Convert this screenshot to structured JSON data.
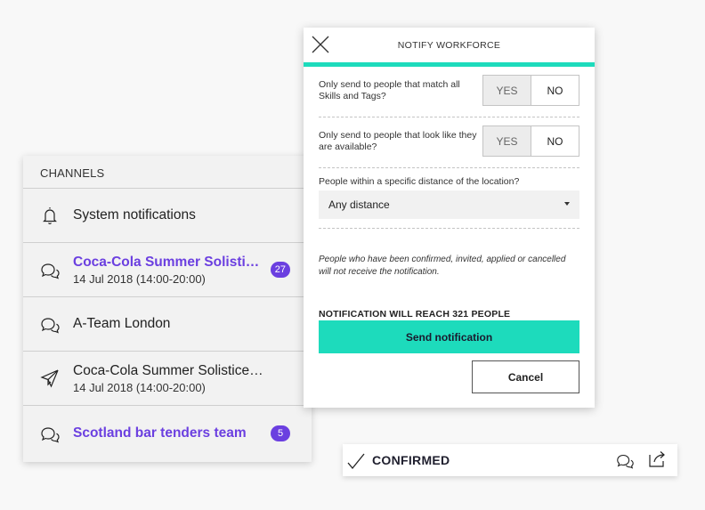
{
  "channels": {
    "header": "CHANNELS",
    "items": [
      {
        "icon": "bell-icon",
        "title": "System notifications",
        "subtitle": "",
        "badge": "",
        "unread": false
      },
      {
        "icon": "chat-bubbles-icon",
        "title": "Coca-Cola Summer Solistic…",
        "subtitle": "14 Jul 2018 (14:00-20:00)",
        "badge": "27",
        "unread": true
      },
      {
        "icon": "chat-bubbles-icon",
        "title": "A-Team London",
        "subtitle": "",
        "badge": "",
        "unread": false
      },
      {
        "icon": "paper-plane-icon",
        "title": "Coca-Cola Summer Solistice event",
        "subtitle": "14 Jul 2018 (14:00-20:00)",
        "badge": "",
        "unread": false
      },
      {
        "icon": "chat-bubbles-icon",
        "title": "Scotland bar tenders team",
        "subtitle": "",
        "badge": "5",
        "unread": true
      }
    ]
  },
  "modal": {
    "title": "NOTIFY WORKFORCE",
    "questions": [
      {
        "text": "Only send to people that match all Skills and Tags?",
        "yes": "YES",
        "no": "NO",
        "selected": "NO"
      },
      {
        "text": "Only send to people that look like they are available?",
        "yes": "YES",
        "no": "NO",
        "selected": "NO"
      }
    ],
    "distance_label": "People within a specific distance of the location?",
    "distance_value": "Any distance",
    "note": "People who have been confirmed, invited, applied or cancelled will not receive the notification.",
    "reach": "NOTIFICATION WILL REACH 321 PEOPLE",
    "send_label": "Send notification",
    "cancel_label": "Cancel"
  },
  "status_bar": {
    "label": "CONFIRMED",
    "icons": [
      "check-icon",
      "chat-bubbles-icon",
      "share-icon"
    ]
  },
  "colors": {
    "accent_teal": "#1ddbbc",
    "accent_purple": "#6b3fe0"
  }
}
